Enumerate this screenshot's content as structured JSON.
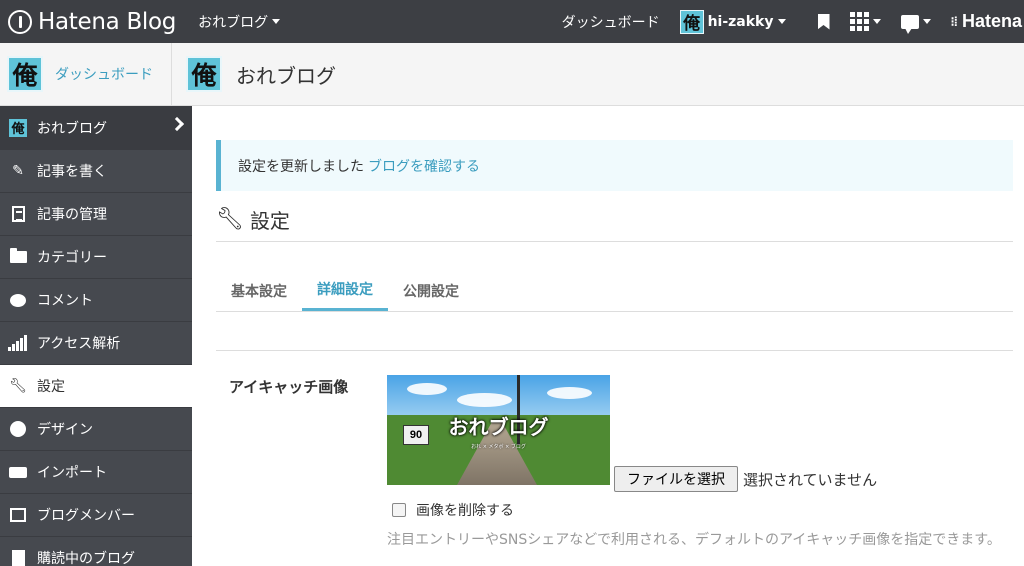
{
  "topbar": {
    "brand": "Hatena Blog",
    "blog_name": "おれブログ",
    "dashboard": "ダッシュボード",
    "avatar_char": "俺",
    "user": "hi-zakky",
    "hatena": "Hatena"
  },
  "subheader": {
    "avatar_char": "俺",
    "dashboard_link": "ダッシュボード",
    "blog_title": "おれブログ"
  },
  "sidebar": {
    "items": [
      {
        "label": "おれブログ",
        "icon": "blog-avatar"
      },
      {
        "label": "記事を書く",
        "icon": "edit-icon"
      },
      {
        "label": "記事の管理",
        "icon": "document-icon"
      },
      {
        "label": "カテゴリー",
        "icon": "folder-icon"
      },
      {
        "label": "コメント",
        "icon": "comment-icon"
      },
      {
        "label": "アクセス解析",
        "icon": "bar-chart-icon"
      },
      {
        "label": "設定",
        "icon": "wrench-icon"
      },
      {
        "label": "デザイン",
        "icon": "palette-icon"
      },
      {
        "label": "インポート",
        "icon": "truck-icon"
      },
      {
        "label": "ブログメンバー",
        "icon": "member-icon"
      },
      {
        "label": "購読中のブログ",
        "icon": "reading-icon"
      }
    ],
    "active_index": 6
  },
  "notice": {
    "text": "設定を更新しました",
    "link": "ブログを確認する"
  },
  "page": {
    "title": "設定",
    "tabs": [
      {
        "label": "基本設定"
      },
      {
        "label": "詳細設定"
      },
      {
        "label": "公開設定"
      }
    ],
    "active_tab": 1
  },
  "eyecatch": {
    "label": "アイキャッチ画像",
    "image_title": "おれブログ",
    "image_subtitle": "おれ × メタボ × ブログ",
    "sign_number": "90",
    "file_button": "ファイルを選択",
    "file_status": "選択されていません",
    "delete_label": "画像を削除する",
    "help": "注目エントリーやSNSシェアなどで利用される、デフォルトのアイキャッチ画像を指定できます。"
  },
  "colors": {
    "topbar_bg": "#3d3f44",
    "sidebar_bg": "#46494f",
    "accent": "#3b9dbf",
    "notice_bg": "#f0fafd"
  }
}
